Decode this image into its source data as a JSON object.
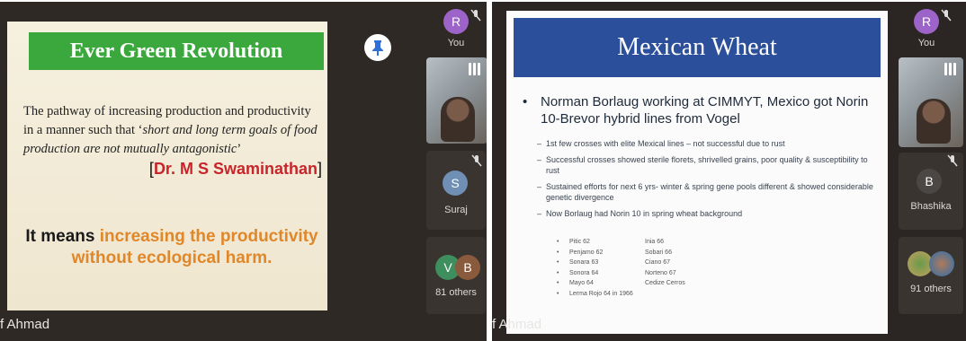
{
  "left_call": {
    "slide": {
      "title": "Ever Green Revolution",
      "quote_start": "The pathway of increasing production and productivity in a manner such that ‘",
      "quote_italic": "short and long  term goals of food production are not mutually antagonistic",
      "quote_end": "’",
      "citation_open": "[",
      "citation": "Dr. M S Swaminathan",
      "citation_close": "]",
      "means_lead": "It means ",
      "means_highlight": "increasing the productivity",
      "means_rest": "without ecological harm."
    },
    "presenter_tag": "f Ahmad",
    "participants": {
      "you_initial": "R",
      "you_label": "You",
      "suraj_initial": "S",
      "suraj_label": "Suraj",
      "group_initials": [
        "V",
        "B"
      ],
      "others_label": "81 others"
    },
    "colors": {
      "banner": "#3aa83c",
      "citation": "#c8242a",
      "highlight": "#e0872a",
      "avatar_you": "#9c64c8",
      "avatar_suraj": "#6f8fb5"
    }
  },
  "right_call": {
    "slide": {
      "title": "Mexican Wheat",
      "bullet": "•",
      "main_point": "Norman Borlaug working at CIMMYT, Mexico got Norin 10-Brevor hybrid lines from Vogel",
      "sub_points": [
        "1st few crosses with elite Mexical lines – not successful due to rust",
        "Successful crosses showed sterile florets, shrivelled grains, poor quality & susceptibility to rust",
        "Sustained efforts for next 6 yrs- winter & spring gene pools different & showed considerable genetic divergence",
        "Now Borlaug had Norin 10 in spring wheat background"
      ],
      "varieties": [
        [
          "Pitic 62",
          "Inia 66"
        ],
        [
          "Penjamo 62",
          "Sobari 66"
        ],
        [
          "Sonara 63",
          "Ciano 67"
        ],
        [
          "Sonora 64",
          "Norteno 67"
        ],
        [
          "Mayo 64",
          "Cedize Cerros"
        ],
        [
          "Lerma Rojo 64  in 1966",
          ""
        ]
      ]
    },
    "presenter_tag": "f Ahmad",
    "participants": {
      "you_initial": "R",
      "you_label": "You",
      "bhashika_initial": "B",
      "bhashika_label": "Bhashika",
      "others_label": "91 others"
    },
    "colors": {
      "banner": "#2c4f9c",
      "avatar_you": "#9c64c8",
      "avatar_bhashika": "#4a4744"
    }
  }
}
